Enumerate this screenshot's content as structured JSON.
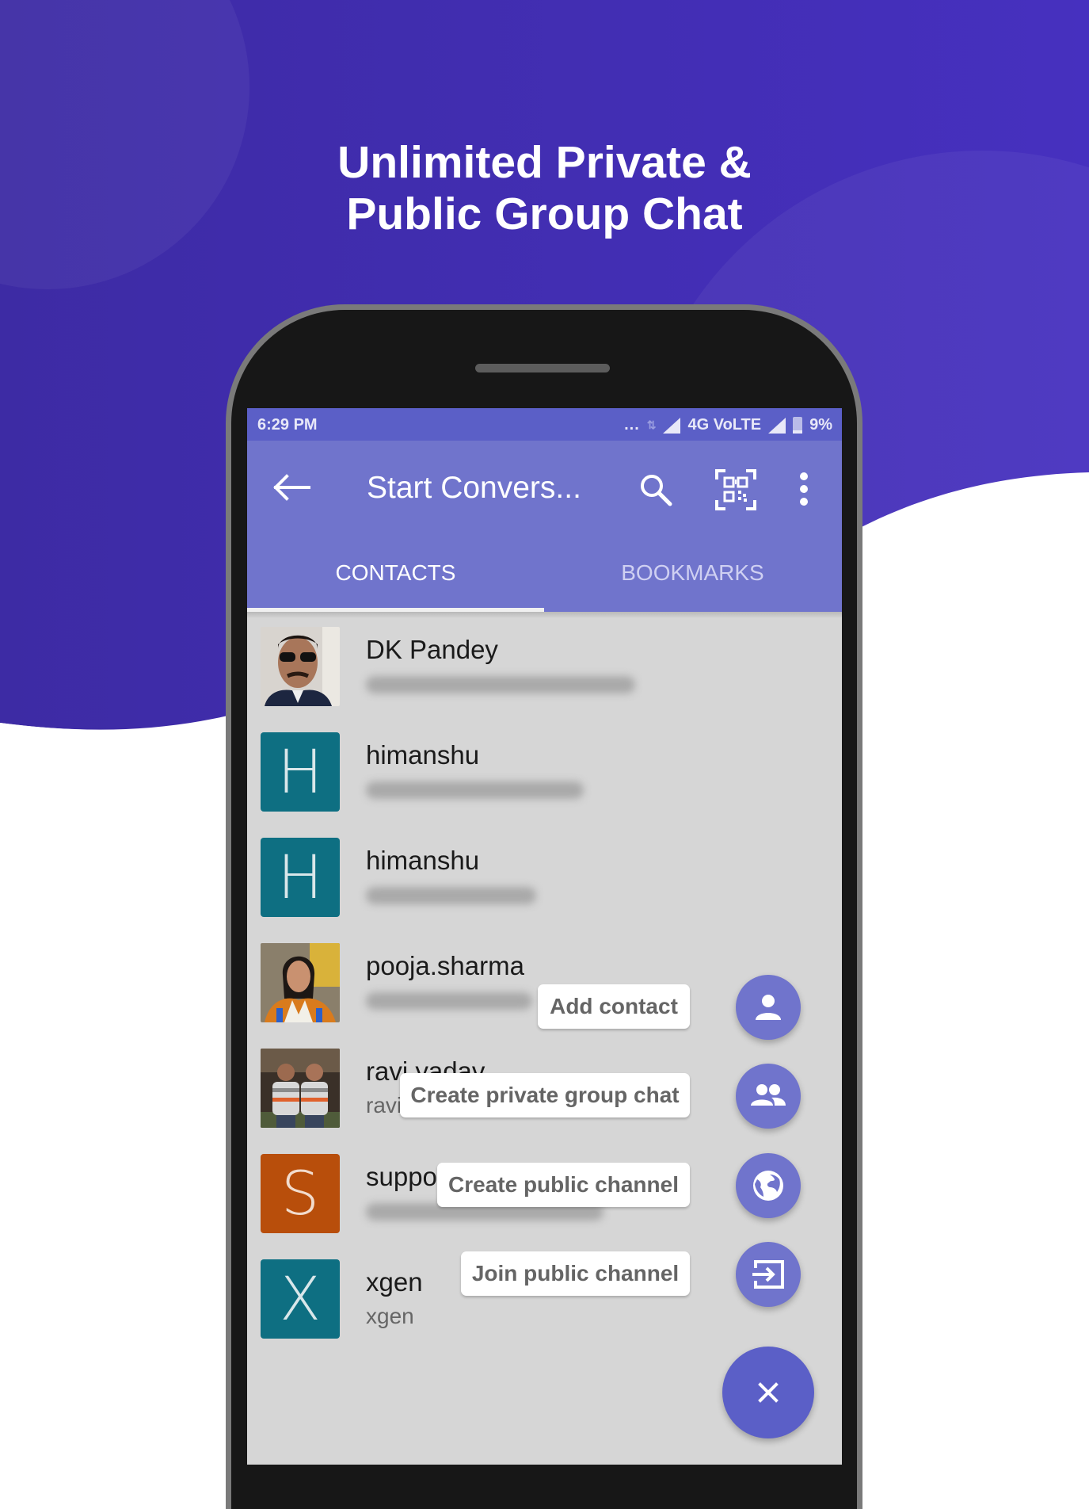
{
  "promo": {
    "headline_line1": "Unlimited Private &",
    "headline_line2": "Public Group Chat",
    "colors": {
      "background_top": "#4a36b5",
      "background_bottom": "#ffffff"
    }
  },
  "status_bar": {
    "time": "6:29 PM",
    "overflow": "...",
    "network": "4G VoLTE",
    "battery": "9%"
  },
  "toolbar": {
    "title": "Start Convers...",
    "icons": [
      "back-arrow-icon",
      "search-icon",
      "qr-code-scan-icon",
      "more-vertical-icon"
    ]
  },
  "tabs": [
    {
      "label": "CONTACTS",
      "active": true
    },
    {
      "label": "BOOKMARKS",
      "active": false
    }
  ],
  "contacts": [
    {
      "name": "DK Pandey",
      "subtitle_blurred": true,
      "avatar": "photo",
      "avatar_letter": ""
    },
    {
      "name": "himanshu",
      "subtitle_blurred": true,
      "avatar": "letter",
      "avatar_letter": "H",
      "avatar_color": "#0e6f82"
    },
    {
      "name": "himanshu",
      "subtitle_blurred": true,
      "avatar": "letter",
      "avatar_letter": "H",
      "avatar_color": "#0e6f82"
    },
    {
      "name": "pooja.sharma",
      "subtitle_blurred": true,
      "avatar": "photo",
      "avatar_letter": ""
    },
    {
      "name": "ravi.yadav",
      "subtitle": "ravi",
      "avatar": "photo",
      "avatar_letter": ""
    },
    {
      "name": "suppo",
      "subtitle_blurred": true,
      "avatar": "letter",
      "avatar_letter": "S",
      "avatar_color": "#b84e0b"
    },
    {
      "name": "xgen",
      "subtitle": "xgen",
      "avatar": "letter",
      "avatar_letter": "X",
      "avatar_color": "#0e6f82"
    }
  ],
  "fab_menu": {
    "items": [
      {
        "label": "Add contact",
        "icon": "person-icon"
      },
      {
        "label": "Create private group chat",
        "icon": "group-icon"
      },
      {
        "label": "Create public channel",
        "icon": "globe-icon"
      },
      {
        "label": "Join public channel",
        "icon": "input-enter-icon"
      }
    ],
    "close_icon": "close-icon",
    "accent": "#7074cc"
  }
}
